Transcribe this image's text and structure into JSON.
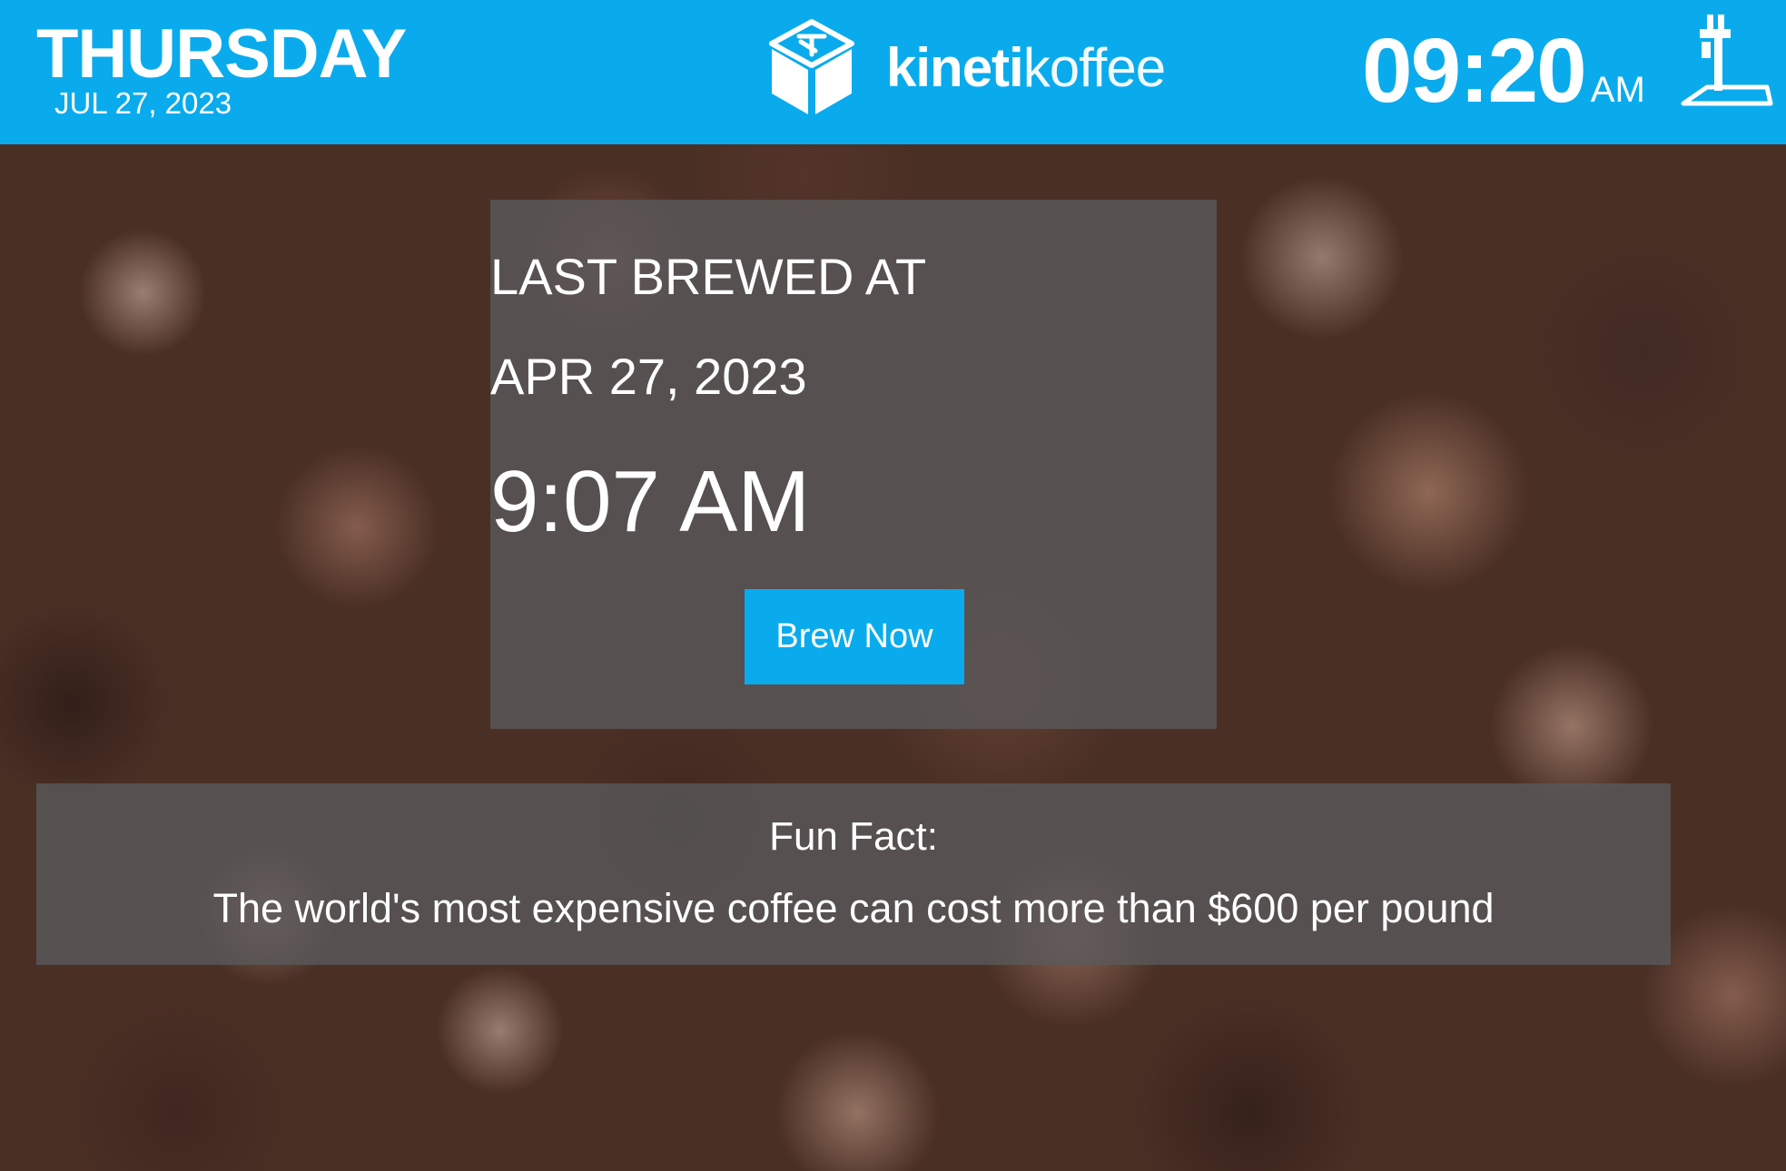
{
  "header": {
    "day": "THURSDAY",
    "date": "JUL 27, 2023",
    "brand": {
      "name_bold": "kineti",
      "name_light": "koffee",
      "icon": "kinetikoffee-cube-logo-icon"
    },
    "clock": {
      "time": "09:20",
      "ampm": "AM"
    },
    "tap_icon": "beer-tap-icon",
    "background_color": "#0aabed"
  },
  "brew_panel": {
    "heading": "LAST BREWED AT",
    "date": "APR 27, 2023",
    "time": "9:07 AM",
    "button_label": "Brew Now"
  },
  "fun_fact": {
    "label": "Fun Fact:",
    "text": "The world's most expensive coffee can cost more than $600 per pound"
  },
  "colors": {
    "accent": "#0aabed",
    "panel": "#5a5a5c",
    "text": "#ffffff"
  }
}
